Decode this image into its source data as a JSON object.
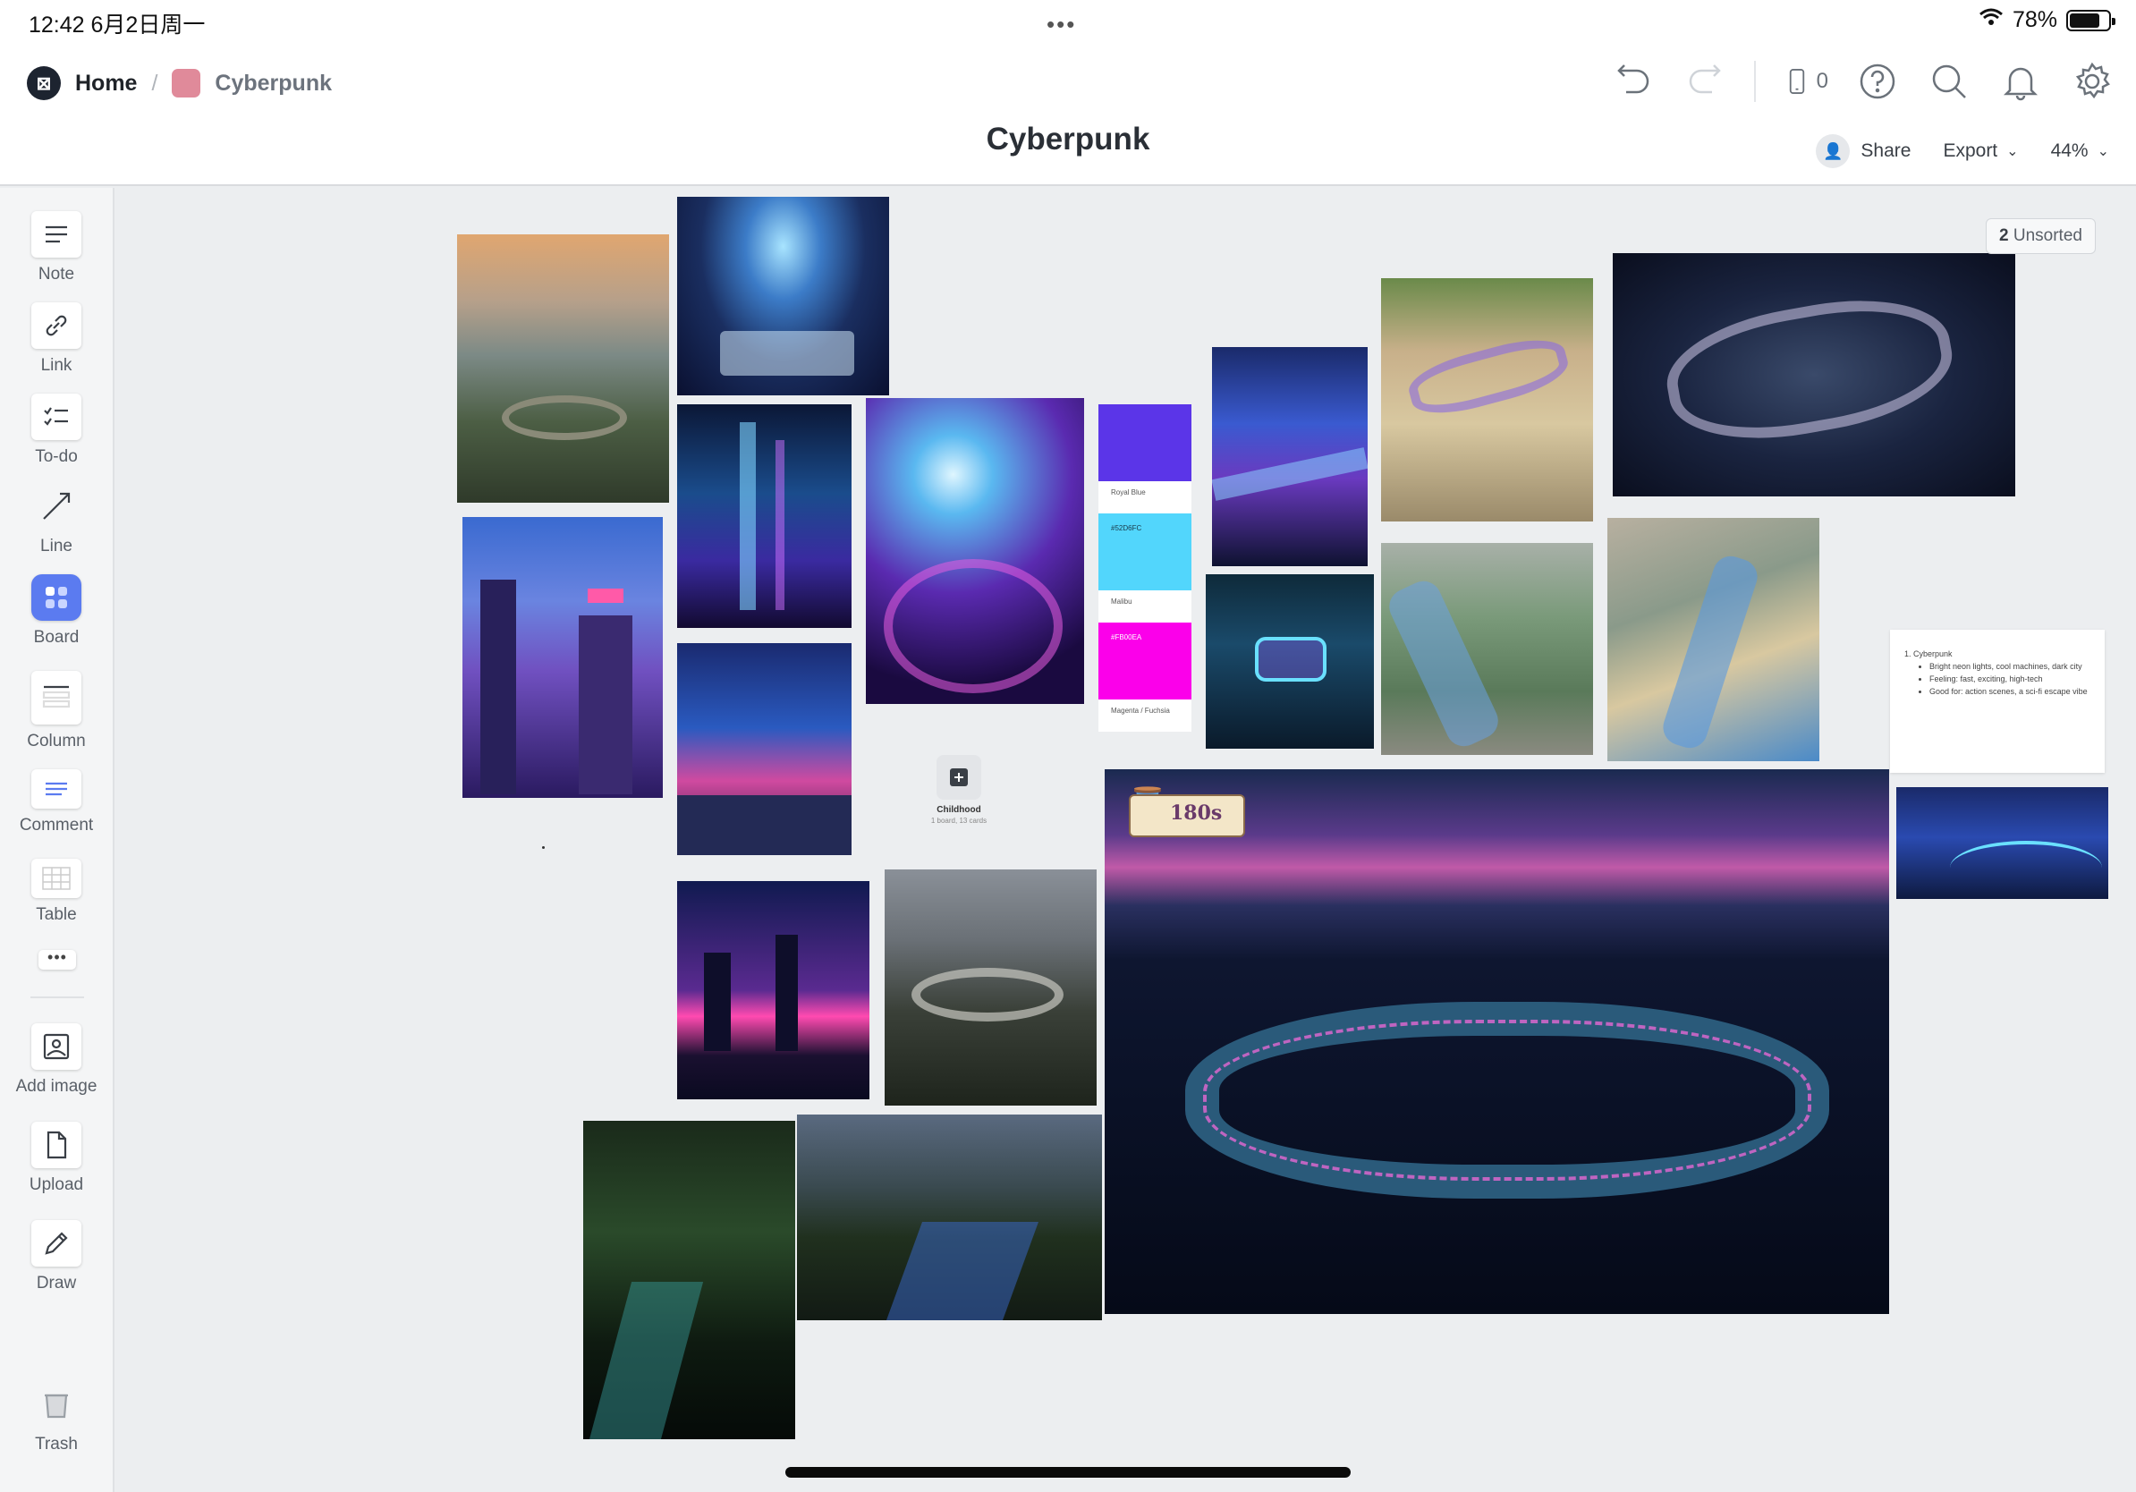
{
  "status_bar": {
    "time_date": "12:42   6月2日周一",
    "dots": "•••",
    "battery_percent": "78%",
    "battery_level": 0.78
  },
  "breadcrumb": {
    "home": "Home",
    "separator": "/",
    "current": "Cyberpunk",
    "board_color": "#e08a9a"
  },
  "header": {
    "device_count": "0",
    "title": "Cyberpunk",
    "share": "Share",
    "export": "Export",
    "zoom": "44%"
  },
  "toolbar": {
    "note": "Note",
    "link": "Link",
    "todo": "To-do",
    "line": "Line",
    "board": "Board",
    "column": "Column",
    "comment": "Comment",
    "table": "Table",
    "more": "•••",
    "add_image": "Add image",
    "upload": "Upload",
    "draw": "Draw",
    "trash": "Trash"
  },
  "unsorted": {
    "count": "2",
    "label": "Unsorted"
  },
  "swatches": [
    {
      "label": "Royal Blue",
      "color": "#5b35e8"
    },
    {
      "label": "Malibu",
      "hex": "#52D6FC",
      "color": "#52d6fc"
    },
    {
      "label": "Magenta / Fuchsia",
      "hex": "#FB00EA",
      "color": "#fb00ea"
    }
  ],
  "board_card": {
    "title": "Childhood",
    "subtitle": "1 board, 13 cards"
  },
  "note_card": {
    "heading": "1. Cyberpunk",
    "bullets": [
      "Bright neon lights, cool machines, dark city",
      "Feeling: fast, exciting, high-tech",
      "Good for: action scenes, a sci-fi escape vibe"
    ]
  },
  "timer_badge": "180s",
  "colors": {
    "accent": "#5b7bf0",
    "canvas": "#eceef0"
  }
}
